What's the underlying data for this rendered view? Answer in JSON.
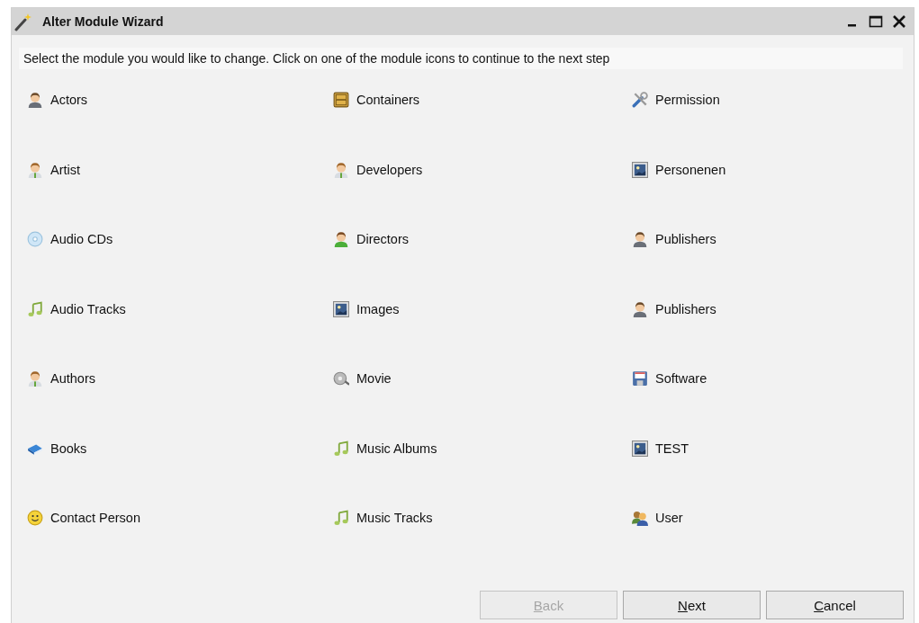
{
  "window": {
    "title": "Alter Module Wizard"
  },
  "instruction": "Select the module you would like to change. Click on one of the module icons to continue to the next step",
  "columns": [
    [
      {
        "label": "Actors",
        "kind": "person"
      },
      {
        "label": "Artist",
        "kind": "person-tie"
      },
      {
        "label": "Audio CDs",
        "kind": "cd"
      },
      {
        "label": "Audio Tracks",
        "kind": "note"
      },
      {
        "label": "Authors",
        "kind": "person-tie"
      },
      {
        "label": "Books",
        "kind": "book"
      },
      {
        "label": "Contact Person",
        "kind": "smiley"
      }
    ],
    [
      {
        "label": "Containers",
        "kind": "cabinet"
      },
      {
        "label": "Developers",
        "kind": "person-tie"
      },
      {
        "label": "Directors",
        "kind": "person-green"
      },
      {
        "label": "Images",
        "kind": "image"
      },
      {
        "label": "Movie",
        "kind": "film"
      },
      {
        "label": "Music Albums",
        "kind": "note"
      },
      {
        "label": "Music Tracks",
        "kind": "note"
      }
    ],
    [
      {
        "label": "Permission",
        "kind": "tools"
      },
      {
        "label": "Personenen",
        "kind": "image"
      },
      {
        "label": "Publishers",
        "kind": "person"
      },
      {
        "label": "Publishers",
        "kind": "person"
      },
      {
        "label": "Software",
        "kind": "floppy"
      },
      {
        "label": "TEST",
        "kind": "image"
      },
      {
        "label": "User",
        "kind": "users"
      }
    ]
  ],
  "buttons": [
    {
      "label": "Back",
      "first_letter_underlined": true,
      "disabled": true
    },
    {
      "label": "Next",
      "first_letter_underlined": true,
      "disabled": false
    },
    {
      "label": "Cancel",
      "first_letter_underlined": true,
      "disabled": false
    }
  ]
}
